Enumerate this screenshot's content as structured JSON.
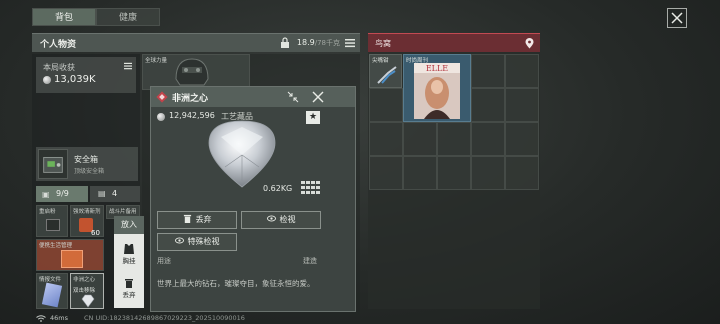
{
  "tabs": [
    {
      "label": "背包"
    },
    {
      "label": "健康"
    }
  ],
  "personal": {
    "title": "个人物资",
    "weight_current": "18.9",
    "weight_max": "/78千克"
  },
  "earnings": {
    "label": "本局收获",
    "value": "13,039K"
  },
  "helmet_slot": {
    "label": "全球力量"
  },
  "safe_box": {
    "title": "安全箱",
    "subtitle": "顶级安全箱"
  },
  "pouch": {
    "slots_label": "9/9",
    "count_label": "4"
  },
  "pouch_items": [
    {
      "label": "重启粉"
    },
    {
      "label": "强效清新剂"
    },
    {
      "label": "战斗片备用"
    },
    {
      "label": "便携生活管理"
    },
    {
      "label": "情报文件"
    },
    {
      "label": "非洲之心"
    }
  ],
  "pouch_extra": {
    "count": "60",
    "tag": "双击移除"
  },
  "context_menu": {
    "header": "放入",
    "items": [
      {
        "label": "胸挂",
        "icon": "vest-icon"
      },
      {
        "label": "丢弃",
        "icon": "trash-icon"
      }
    ]
  },
  "detail": {
    "title": "非洲之心",
    "price": "12,942,596",
    "category": "工艺藏品",
    "weight": "0.62KG",
    "buttons": {
      "drop": "丢弃",
      "inspect": "检视",
      "special": "特殊检视"
    },
    "use_label": "用途",
    "build_label": "建造",
    "description": "世界上最大的钻石，璀璨夺目，象征永恒的爱。"
  },
  "nest": {
    "title": "鸟窝",
    "items": [
      {
        "label": "尖嘴钳"
      },
      {
        "label": "时尚周刊"
      }
    ]
  },
  "status": {
    "ping": "46ms",
    "uid": "CN UID:18238142689867029223_202510090016"
  },
  "colors": {
    "accent_green": "#5c6a60",
    "nest_red": "#6b2e33"
  }
}
